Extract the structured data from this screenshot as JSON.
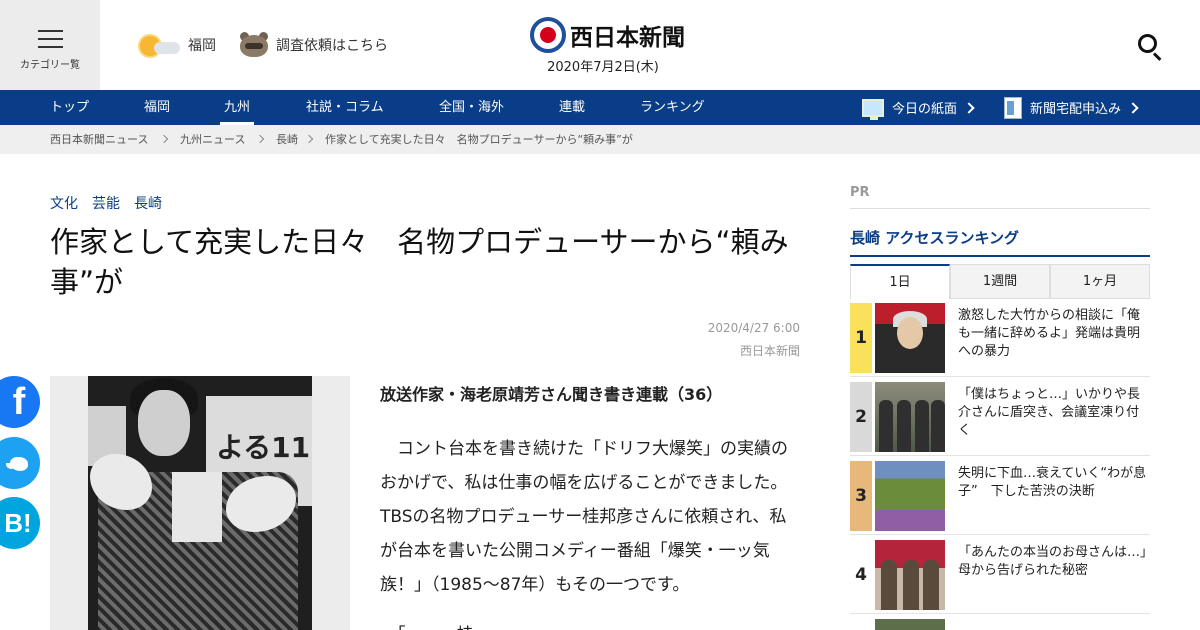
{
  "header": {
    "menu_label": "カテゴリー覧",
    "weather_location": "福岡",
    "request_label": "調査依頼はこちら",
    "logo_text": "西日本新聞",
    "date": "2020年7月2日(木)"
  },
  "nav": {
    "items": [
      "トップ",
      "福岡",
      "九州",
      "社説・コラム",
      "全国・海外",
      "連載",
      "ランキング"
    ],
    "active": "九州",
    "today_paper": "今日の紙面",
    "delivery": "新聞宅配申込み"
  },
  "breadcrumbs": [
    "西日本新聞ニュース",
    "九州ニュース",
    "長崎",
    "作家として充実した日々　名物プロデューサーから“頼み事”が"
  ],
  "article": {
    "tags": [
      "文化",
      "芸能",
      "長崎"
    ],
    "title": "作家として充実した日々　名物プロデューサーから“頼み事”が",
    "date": "2020/4/27 6:00",
    "source": "西日本新聞",
    "photo_sign_text": "よる11",
    "subhead": "放送作家・海老原靖芳さん聞き書き連載（36）",
    "paragraph1": "　コント台本を書き続けた「ドリフ大爆笑」の実績のおかげで、私は仕事の幅を広げることができました。TBSの名物プロデューサー桂邦彦さんに依頼され、私が台本を書いた公開コメディー番組「爆笑・一ッ気族！」（1985～87年）もその一つです。",
    "paragraph2": "　「……」桂……"
  },
  "social": {
    "facebook": "f",
    "hatena": "B!"
  },
  "sidebar": {
    "pr_label": "PR",
    "ranking_title": "長崎 アクセスランキング",
    "tabs": [
      "1日",
      "1週間",
      "1ヶ月"
    ],
    "active_tab": "1日",
    "items": [
      {
        "rank": "1",
        "text": "激怒した大竹からの相談に「俺も一緒に辞めるよ」発端は貴明への暴力"
      },
      {
        "rank": "2",
        "text": "「僕はちょっと…」いかりや長介さんに盾突き、会議室凍り付く"
      },
      {
        "rank": "3",
        "text": "失明に下血…衰えていく“わが息子”　下した苦渋の決断"
      },
      {
        "rank": "4",
        "text": "「あんたの本当のお母さんは…」母から告げられた秘密"
      }
    ]
  },
  "colors": {
    "nav_bg": "#0a3d87",
    "brand_red": "#d7001a",
    "rank1": "#f9e15b",
    "rank2": "#d9d9d9",
    "rank3": "#e8b87a"
  }
}
